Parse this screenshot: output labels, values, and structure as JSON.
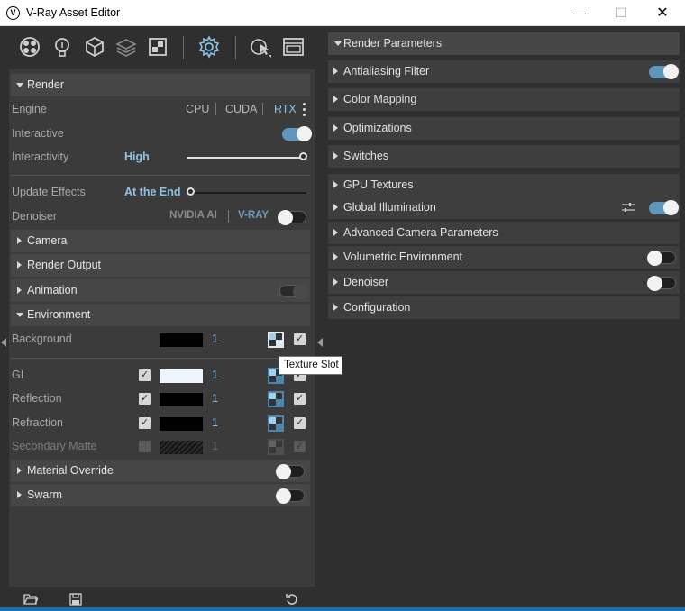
{
  "window": {
    "title": "V-Ray Asset Editor",
    "icon_letter": "V",
    "minimize": "—",
    "maximize": "☐",
    "close": "✕"
  },
  "toolbar": {
    "icons": [
      "materials-icon",
      "lights-icon",
      "geometry-icon",
      "layers-icon",
      "textures-icon",
      "settings-icon",
      "render-interactive-icon",
      "render-window-icon"
    ]
  },
  "render": {
    "section_label": "Render",
    "engine_label": "Engine",
    "engine_options": [
      "CPU",
      "CUDA",
      "RTX"
    ],
    "engine_selected": "RTX",
    "interactive_label": "Interactive",
    "interactive_on": true,
    "interactivity_label": "Interactivity",
    "interactivity_value": "High",
    "update_effects_label": "Update Effects",
    "update_effects_value": "At the End",
    "denoiser_label": "Denoiser",
    "denoiser_options": [
      "NVIDIA AI",
      "V-RAY"
    ],
    "denoiser_selected": "V-RAY",
    "denoiser_on": false
  },
  "sections": {
    "camera": "Camera",
    "render_output": "Render Output",
    "animation": "Animation",
    "environment": "Environment",
    "material_override": "Material Override",
    "swarm": "Swarm"
  },
  "environment": {
    "rows": [
      {
        "label": "Background",
        "color": "#000000",
        "value": "1",
        "has_check": false,
        "enabled": true
      },
      {
        "label": "GI",
        "color": "#eef5ff",
        "value": "1",
        "has_check": true,
        "enabled": true
      },
      {
        "label": "Reflection",
        "color": "#000000",
        "value": "1",
        "has_check": true,
        "enabled": true
      },
      {
        "label": "Refraction",
        "color": "#000000",
        "value": "1",
        "has_check": true,
        "enabled": true
      },
      {
        "label": "Secondary Matte",
        "color": "#1a1a1a",
        "value": "1",
        "has_check": true,
        "enabled": false
      }
    ],
    "tooltip": "Texture Slot"
  },
  "right_panel": {
    "header": "Render Parameters",
    "items": [
      {
        "label": "Antialiasing Filter",
        "toggle": "on"
      },
      {
        "label": "Color Mapping",
        "toggle": "none"
      },
      {
        "label": "Optimizations",
        "toggle": "none"
      },
      {
        "label": "Switches",
        "toggle": "none"
      },
      {
        "label": "GPU Textures",
        "toggle": "none"
      },
      {
        "label": "Global Illumination",
        "toggle": "on",
        "settings_icon": true
      },
      {
        "label": "Advanced Camera Parameters",
        "toggle": "none"
      },
      {
        "label": "Volumetric Environment",
        "toggle": "off"
      },
      {
        "label": "Denoiser",
        "toggle": "off"
      },
      {
        "label": "Configuration",
        "toggle": "none"
      }
    ]
  },
  "colors": {
    "accent": "#8cc2e6",
    "toggle_on": "#5f97bb",
    "bottom_bar": "#1e6fa8"
  }
}
